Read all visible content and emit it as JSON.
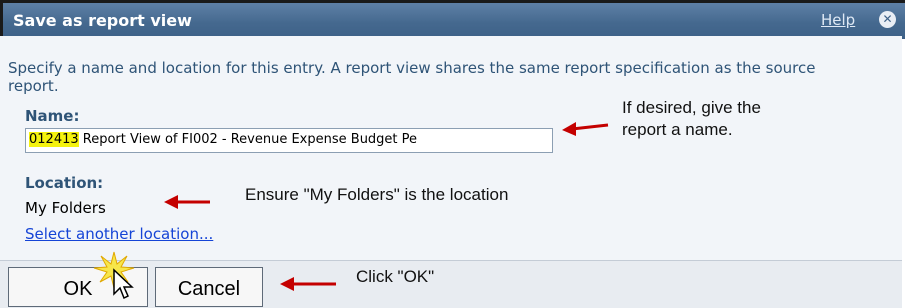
{
  "dialog": {
    "title": "Save as report view",
    "help_label": "Help",
    "close_icon": "close-icon",
    "description": "Specify a name and location for this entry. A report view shares the same report specification as the source report.",
    "name_label": "Name:",
    "name_value_highlighted": "012413",
    "name_value_rest": " Report View of FI002 - Revenue Expense Budget Pe",
    "location_label": "Location:",
    "location_value": "My Folders",
    "select_location_link": "Select another location...",
    "ok_label": "OK",
    "cancel_label": "Cancel"
  },
  "annotations": {
    "name_note": "If desired, give the report a name.",
    "location_note": "Ensure \"My Folders\" is the location",
    "ok_note": "Click \"OK\""
  },
  "colors": {
    "title_bar": "#45698f",
    "label_text": "#2f5477",
    "link": "#1544d6",
    "highlight": "#f4f20e",
    "arrow": "#c40000"
  }
}
